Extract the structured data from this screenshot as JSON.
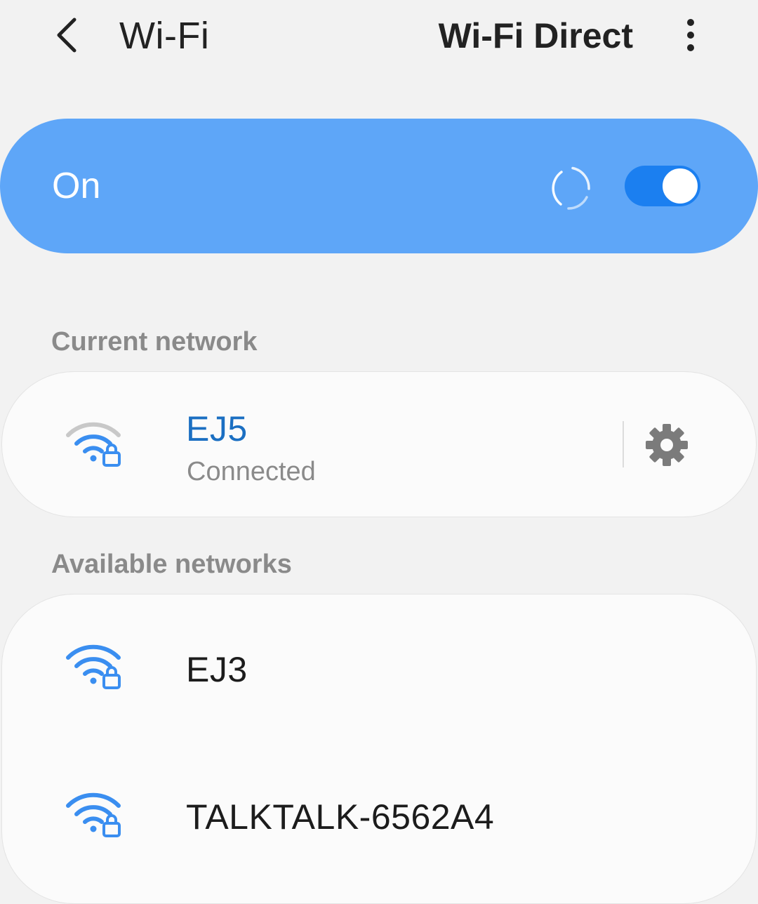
{
  "header": {
    "title": "Wi-Fi",
    "wifi_direct_label": "Wi-Fi Direct"
  },
  "master_switch": {
    "label": "On",
    "enabled": true
  },
  "sections": {
    "current_network_label": "Current network",
    "available_networks_label": "Available networks"
  },
  "current_network": {
    "name": "EJ5",
    "status": "Connected",
    "secured": true,
    "icon": "wifi-lock-icon"
  },
  "available_networks": [
    {
      "name": "EJ3",
      "secured": true,
      "icon": "wifi-lock-icon"
    },
    {
      "name": "TALKTALK-6562A4",
      "secured": true,
      "icon": "wifi-lock-icon"
    }
  ],
  "colors": {
    "accent": "#5ea6f8",
    "toggle": "#1b7ff0",
    "connected_text": "#1b6fc2",
    "wifi_icon": "#3a8ef0",
    "background": "#f2f2f2"
  }
}
